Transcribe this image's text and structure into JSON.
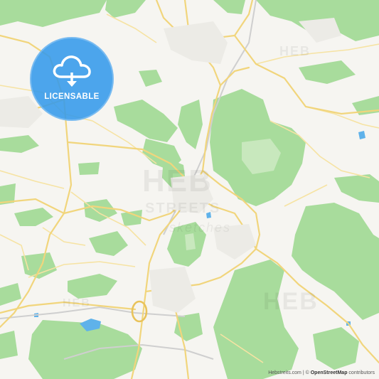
{
  "badge": {
    "label": "LICENSABLE",
    "icon": "cloud-download-icon",
    "color": "#349AEA"
  },
  "watermark": {
    "brand": "HEB",
    "brand_line2": "STREETS",
    "tagline": "sketches"
  },
  "attribution": {
    "site": "Hebstreits.com",
    "separator": "|",
    "copyright": "©",
    "osm": "OpenStreetMap",
    "suffix": "contributors"
  },
  "colors": {
    "land": "#F6F5F1",
    "forest": "#A6DB9A",
    "road": "#F2D77E",
    "water": "#5AB1EA",
    "rail": "#CFCFCF"
  }
}
